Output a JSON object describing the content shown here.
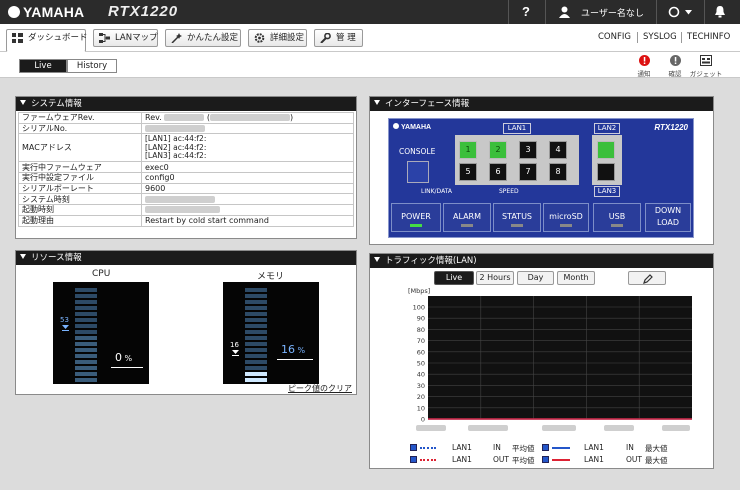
{
  "header": {
    "brand": "YAMAHA",
    "model": "RTX1220",
    "help": "?",
    "user": "ユーザー名なし"
  },
  "toolbar": {
    "tabs": [
      "ダッシュボード",
      "LANマップ",
      "かんたん設定",
      "詳細設定",
      "管 理"
    ],
    "links": [
      "CONFIG",
      "SYSLOG",
      "TECHINFO"
    ]
  },
  "subtabs": [
    "Live",
    "History"
  ],
  "mini_icons": [
    "通知",
    "確認",
    "ガジェット"
  ],
  "system_info": {
    "title": "システム情報",
    "rows": [
      {
        "k": "ファームウェアRev.",
        "v": "Rev."
      },
      {
        "k": "シリアルNo.",
        "v": ""
      },
      {
        "k": "MACアドレス",
        "v": "[LAN1] ac:44:f2:\n[LAN2] ac:44:f2:\n[LAN3] ac:44:f2:"
      },
      {
        "k": "実行中ファームウェア",
        "v": "exec0"
      },
      {
        "k": "実行中設定ファイル",
        "v": "config0"
      },
      {
        "k": "シリアルボーレート",
        "v": "9600"
      },
      {
        "k": "システム時刻",
        "v": ""
      },
      {
        "k": "起動時刻",
        "v": ""
      },
      {
        "k": "起動理由",
        "v": "Restart by cold start command"
      }
    ]
  },
  "resource": {
    "title": "リソース情報",
    "cpu_label": "CPU",
    "mem_label": "メモリ",
    "cpu_value": "0",
    "cpu_unit": "%",
    "cpu_peak": "53",
    "mem_value": "16",
    "mem_unit": "%",
    "mem_peak": "16",
    "clear": "ピーク値のクリア"
  },
  "interface": {
    "title": "インターフェース情報",
    "brand": "YAMAHA",
    "model": "RTX1220",
    "console": "CONSOLE",
    "lan1": "LAN1",
    "lan2": "LAN2",
    "lan3": "LAN3",
    "linkdata": "LINK/DATA",
    "speed": "SPEED",
    "ports": [
      "1",
      "2",
      "3",
      "4",
      "5",
      "6",
      "7",
      "8"
    ],
    "status_buttons": [
      "POWER",
      "ALARM",
      "STATUS",
      "microSD",
      "USB",
      "DOWN\nLOAD"
    ]
  },
  "traffic": {
    "title": "トラフィック情報(LAN)",
    "buttons": [
      "Live",
      "2 Hours",
      "Day",
      "Month"
    ],
    "unit": "[Mbps]",
    "legend": [
      {
        "name": "LAN1",
        "dir": "IN",
        "stat": "平均値"
      },
      {
        "name": "LAN1",
        "dir": "IN",
        "stat": "最大値"
      },
      {
        "name": "LAN1",
        "dir": "OUT",
        "stat": "平均値"
      },
      {
        "name": "LAN1",
        "dir": "OUT",
        "stat": "最大値"
      }
    ]
  },
  "chart_data": {
    "type": "line",
    "ylabel": "[Mbps]",
    "ylim": [
      0,
      100
    ],
    "yticks": [
      0,
      10,
      20,
      30,
      40,
      50,
      60,
      70,
      80,
      90,
      100
    ],
    "series": [
      {
        "name": "LAN1 IN 平均値",
        "values": [
          0
        ]
      },
      {
        "name": "LAN1 IN 最大値",
        "values": [
          0
        ]
      },
      {
        "name": "LAN1 OUT 平均値",
        "values": [
          0
        ]
      },
      {
        "name": "LAN1 OUT 最大値",
        "values": [
          0
        ]
      }
    ]
  }
}
